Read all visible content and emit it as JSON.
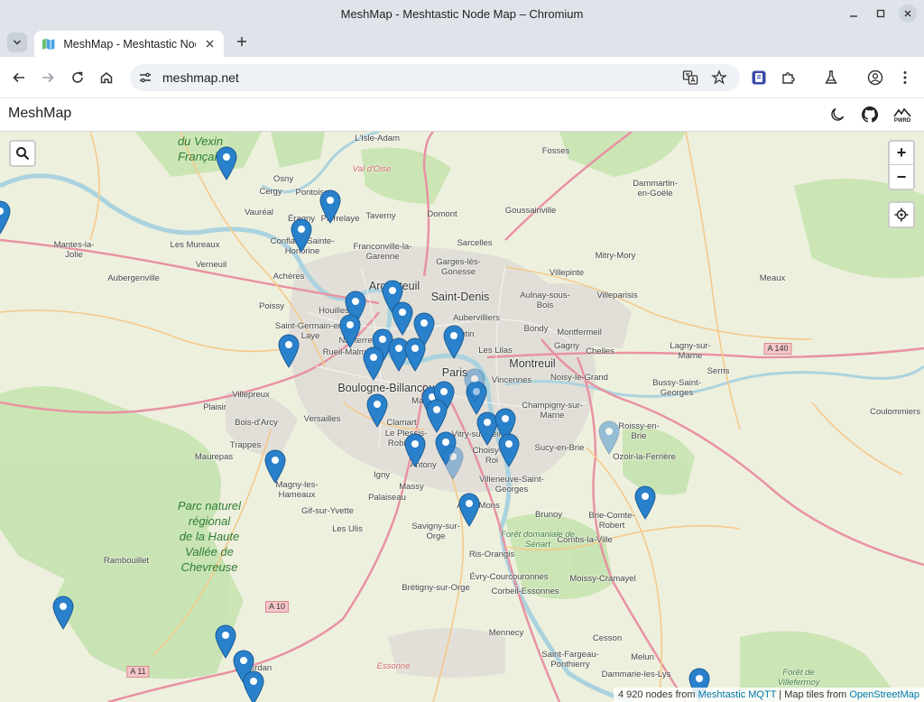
{
  "window": {
    "title": "MeshMap - Meshtastic Node Map – Chromium"
  },
  "tabs": [
    {
      "title": "MeshMap - Meshtastic Node Map",
      "active": true
    }
  ],
  "toolbar": {
    "url": "meshmap.net"
  },
  "app": {
    "brand": "MeshMap"
  },
  "colors": {
    "marker": "#2a81cb",
    "accent": "#0078a8"
  },
  "icons": {
    "header": [
      "moon-icon",
      "github-icon",
      "pwrd-logo"
    ],
    "map": [
      "search-icon",
      "zoom-in-icon",
      "zoom-out-icon",
      "locate-icon"
    ]
  },
  "header": {
    "pwrd_label": "PWRD"
  },
  "map_controls": {
    "zoom_in": "+",
    "zoom_out": "−"
  },
  "attribution": {
    "prefix": "4 920 nodes from ",
    "mqtt_link": "Meshtastic MQTT",
    "separator": " | Map tiles from ",
    "osm_link": "OpenStreetMap"
  },
  "places": [
    "L'Isle-Adam",
    "Fosses",
    "du Vexin",
    "Français",
    "Osny",
    "Val d'Oise",
    "Pontoise",
    "Cergy",
    "Dammartin-en-Goële",
    "Vauréal",
    "Éragny",
    "Pierrelaye",
    "Taverny",
    "Domont",
    "Goussainville",
    "Mantes-la-Jolie",
    "Les Mureaux",
    "Conflans-Sainte-Honorine",
    "Franconville-la-Garenne",
    "Sarcelles",
    "Mitry-Mory",
    "Verneuil",
    "Garges-lès-Gonesse",
    "Aubergenville",
    "Achères",
    "Villepinte",
    "Meaux",
    "Argenteuil",
    "Saint-Denis",
    "Aulnay-sous-Bois",
    "Villeparisis",
    "Poissy",
    "Houilles",
    "Aubervilliers",
    "Saint-Germain-en-Laye",
    "Nanterre",
    "Pantin",
    "Bondy",
    "Montfermeil",
    "Rueil-Malmaison",
    "Les Lilas",
    "Gagny",
    "Chelles",
    "Lagny-sur-Marne",
    "A 140",
    "Paris",
    "Montreuil",
    "Vincennes",
    "Noisy-le-Grand",
    "Boulogne-Billancourt",
    "Serris",
    "Bussy-Saint-Georges",
    "Villepreux",
    "Plaisir",
    "Malakoff",
    "Champigny-sur-Marne",
    "Bois-d'Arcy",
    "Versailles",
    "Clamart",
    "Vitry-sur-Seine",
    "Roissy-en-Brie",
    "Coulommiers",
    "Trappes",
    "Le Plessis-Robinson",
    "Choisy-le-Roi",
    "Sucy-en-Brie",
    "Maurepas",
    "Ozoir-la-Ferrière",
    "Antony",
    "Villeneuve-Saint-Georges",
    "Igny",
    "Magny-les-Hameaux",
    "Massy",
    "Palaiseau",
    "Athis-Mons",
    "Brunoy",
    "Gif-sur-Yvette",
    "Brie-Comte-Robert",
    "Les Ulis",
    "Savigny-sur-Orge",
    "Combs-la-Ville",
    "Forêt domaniale de Sénart",
    "Rambouillet",
    "Ris-Orangis",
    "Évry-Courcouronnes",
    "Moissy-Cramayel",
    "Corbeil-Essonnes",
    "Brétigny-sur-Orge",
    "A 10",
    "Mennecy",
    "Cesson",
    "Saint-Fargeau-Ponthierry",
    "Melun",
    "A 11",
    "Dourdan",
    "Essonne",
    "Dammarie-les-Lys",
    "Forêt de Villefermoy"
  ],
  "park_labels": [
    "Parc naturel",
    "régional",
    "de la Haute",
    "Vallée de",
    "Chevreuse"
  ],
  "node_count": 4920,
  "markers": [
    {
      "lat": 49.07,
      "lon": 1.82
    }
  ]
}
